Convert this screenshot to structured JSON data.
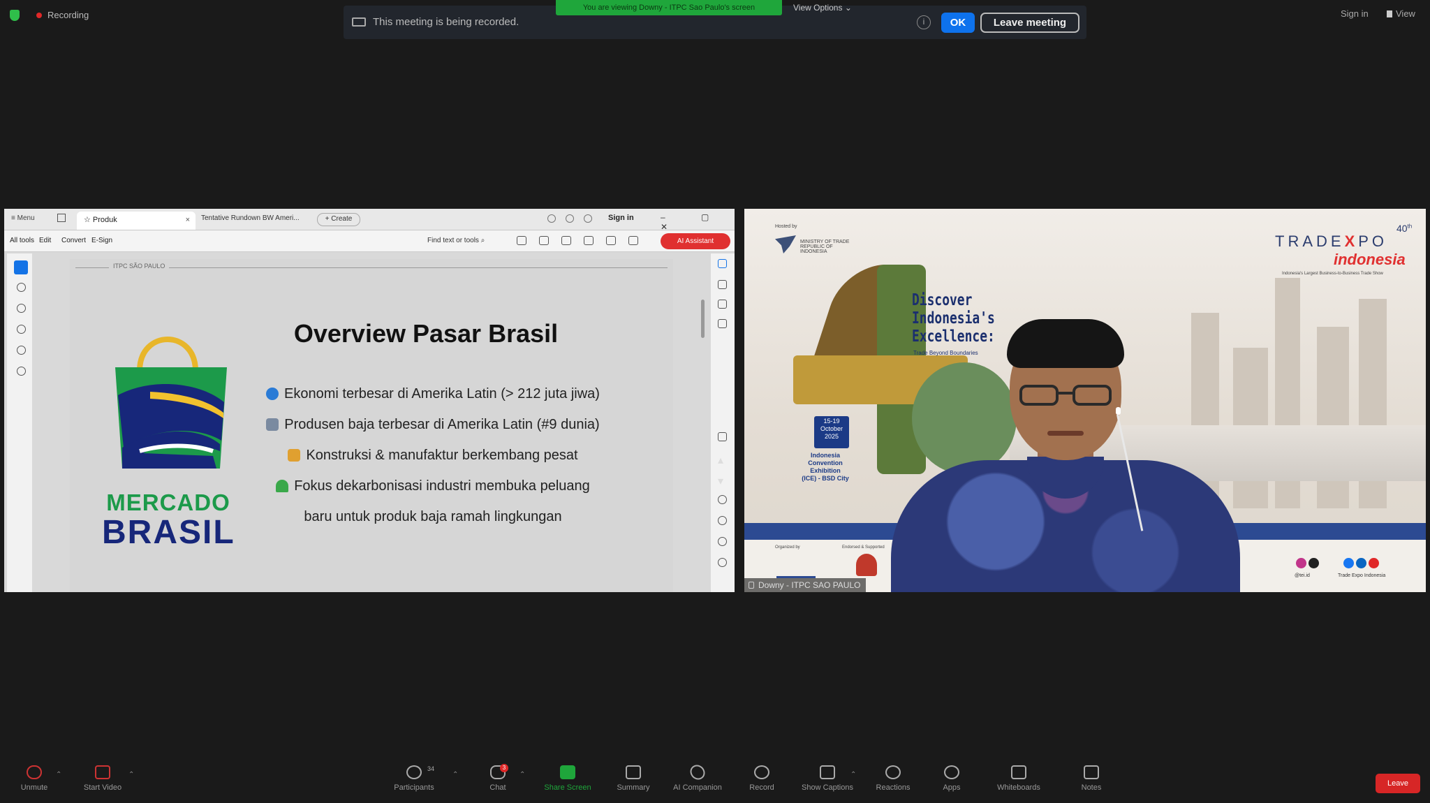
{
  "top": {
    "recording_label": "Recording",
    "recording_message": "This meeting is being recorded.",
    "viewing_label": "You are viewing Downy - ITPC Sao Paulo's screen",
    "view_options": "View Options",
    "ok_button": "OK",
    "leave_meeting_button": "Leave meeting",
    "sign_in": "Sign in",
    "view": "View"
  },
  "shared_screen": {
    "browser": {
      "menu": "Menu",
      "active_tab": "Produk",
      "tab_close": "×",
      "tab_2": "Tentative Rundown BW Ameri...",
      "create_tab": "+ Create",
      "sign_in": "Sign in",
      "window_controls": "– ▢ ✕"
    },
    "toolbar": {
      "menu_items": [
        "All tools",
        "Edit",
        "Convert",
        "E-Sign"
      ],
      "find": "Find text or tools",
      "ai_assistant": "AI Assistant"
    },
    "page_header": "ITPC SÃO PAULO",
    "slide": {
      "logo_line1": "MERCADO",
      "logo_line2": "BRASIL",
      "title": "Overview Pasar Brasil",
      "bullets": [
        "Ekonomi terbesar di Amerika Latin (> 212 juta jiwa)",
        "Produsen baja terbesar di Amerika Latin (#9 dunia)",
        "Konstruksi & manufaktur berkembang pesat",
        "Fokus dekarbonisasi industri membuka peluang",
        "baru untuk produk baja ramah lingkungan"
      ],
      "bullet_icon_colors": [
        "#2a7bd6",
        "#7a8aa0",
        "#e0a030",
        "#3aa84a",
        "transparent"
      ]
    }
  },
  "speaker_tile": {
    "hosted_by": "Hosted by",
    "ministry": "MINISTRY OF TRADE REPUBLIC OF INDONESIA",
    "discover_line1": "Discover",
    "discover_line2": "Indonesia's",
    "discover_line3": "Excellence:",
    "discover_sub": "Trade Beyond Boundaries",
    "date_line1": "15-19",
    "date_line2": "October",
    "date_line3": "2025",
    "venue_line1": "Indonesia",
    "venue_line2": "Convention",
    "venue_line3": "Exhibition",
    "venue_line4": "(ICE) - BSD City",
    "brand_left": "TRADE",
    "brand_x": "X",
    "brand_right": "PO",
    "edition": "40",
    "edition_suffix": "th",
    "brand_sub": "indonesia",
    "tagline": "Indonesia's Largest Business-to-Business Trade Show",
    "organized_by": "Organized by",
    "supported_by": "Endorsed & Supported",
    "social_caption_1": "@tei.id",
    "social_caption_2": "Trade Expo Indonesia",
    "participant_name": "Downy - ITPC SAO PAULO"
  },
  "controls": {
    "unmute": "Unmute",
    "start_video": "Start Video",
    "participants": "Participants",
    "participant_count": "34",
    "chat": "Chat",
    "chat_badge": "3",
    "share_screen": "Share Screen",
    "summary": "Summary",
    "ai_companion": "AI Companion",
    "record": "Record",
    "show_captions": "Show Captions",
    "reactions": "Reactions",
    "apps": "Apps",
    "whiteboards": "Whiteboards",
    "notes": "Notes",
    "leave": "Leave"
  },
  "colors": {
    "zoom_blue": "#0e72ed",
    "share_green": "#1fa63b",
    "leave_red": "#d72626",
    "brasil_green": "#1c9a4a",
    "brasil_blue": "#17277a"
  }
}
